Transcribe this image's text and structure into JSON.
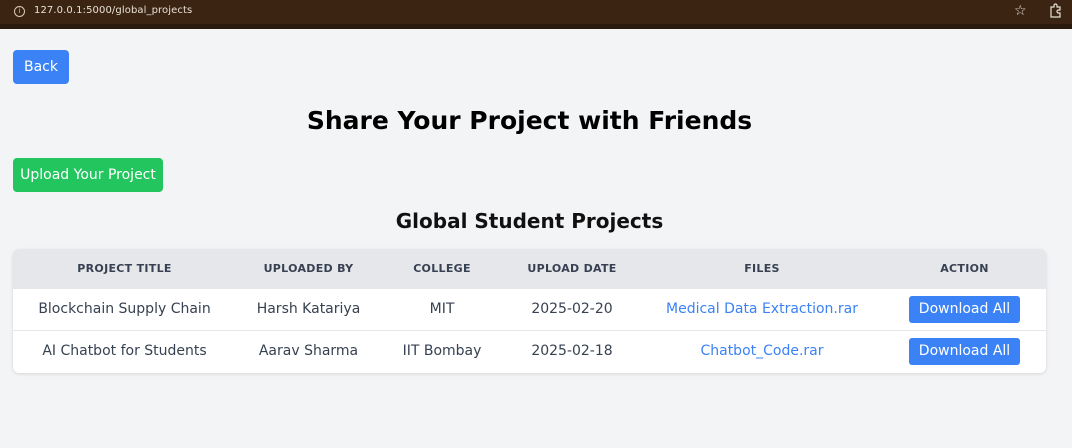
{
  "browser": {
    "url": "127.0.0.1:5000/global_projects",
    "info_icon": "i"
  },
  "back_label": "Back",
  "title": "Share Your Project with Friends",
  "upload_label": "Upload Your Project",
  "section_title": "Global Student Projects",
  "table": {
    "headers": [
      "PROJECT TITLE",
      "UPLOADED BY",
      "COLLEGE",
      "UPLOAD DATE",
      "FILES",
      "ACTION"
    ],
    "rows": [
      {
        "title": "Blockchain Supply Chain",
        "uploaded_by": "Harsh Katariya",
        "college": "MIT",
        "date": "2025-02-20",
        "file": "Medical Data Extraction.rar",
        "action": "Download All"
      },
      {
        "title": "AI Chatbot for Students",
        "uploaded_by": "Aarav Sharma",
        "college": "IIT Bombay",
        "date": "2025-02-18",
        "file": "Chatbot_Code.rar",
        "action": "Download All"
      }
    ]
  },
  "colors": {
    "primary": "#3b82f6",
    "success": "#22c55e",
    "header_bg": "#e5e7eb",
    "page_bg": "#f3f4f6"
  },
  "icons": [
    "info-icon",
    "star-icon",
    "extensions-icon"
  ]
}
